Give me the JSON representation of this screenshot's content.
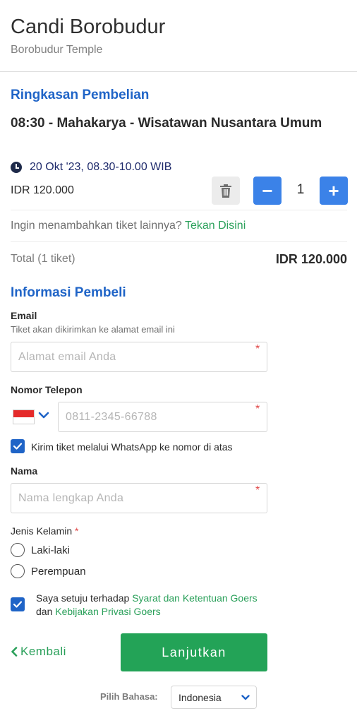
{
  "header": {
    "title": "Candi Borobudur",
    "subtitle": "Borobudur Temple"
  },
  "summary": {
    "section_title": "Ringkasan Pembelian",
    "ticket_name": "08:30 - Mahakarya - Wisatawan Nusantara Umum",
    "schedule": "20 Okt '23, 08.30-10.00 WIB",
    "price": "IDR 120.000",
    "quantity": "1",
    "minus_symbol": "−",
    "plus_symbol": "+",
    "add_more_text": "Ingin menambahkan tiket lainnya?",
    "add_more_link": "Tekan Disini",
    "total_label": "Total (1 tiket)",
    "total_value": "IDR 120.000"
  },
  "buyer": {
    "section_title": "Informasi Pembeli",
    "email_label": "Email",
    "email_hint": "Tiket akan dikirimkan ke alamat email ini",
    "email_placeholder": "Alamat email Anda",
    "phone_label": "Nomor Telepon",
    "phone_placeholder": "0811-2345-66788",
    "whatsapp_label": "Kirim tiket melalui WhatsApp ke nomor di atas",
    "name_label": "Nama",
    "name_placeholder": "Nama lengkap Anda",
    "required_mark": "*",
    "gender_label": "Jenis Kelamin",
    "gender_options": [
      "Laki-laki",
      "Perempuan"
    ],
    "terms_prefix": "Saya setuju terhadap",
    "terms_link": "Syarat dan Ketentuan Goers",
    "terms_middle": "dan",
    "privacy_link": "Kebijakan Privasi Goers"
  },
  "footer": {
    "back_label": "Kembali",
    "next_label": "Lanjutkan",
    "language_label": "Pilih Bahasa:",
    "language_value": "Indonesia"
  },
  "colors": {
    "accent_blue": "#1f64c7",
    "button_blue": "#3b82e8",
    "green": "#23a357",
    "required_red": "#e04848"
  },
  "icons": {
    "schedule": "clock-icon",
    "delete": "trash-icon",
    "country": "indonesia-flag-icon",
    "dropdown": "chevron-down-icon",
    "back": "chevron-left-icon"
  }
}
